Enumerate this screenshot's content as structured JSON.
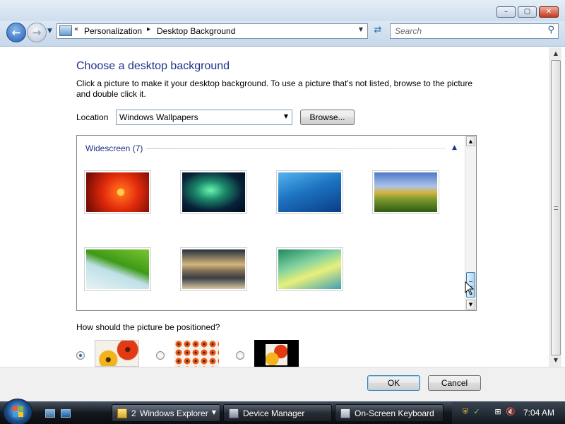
{
  "window": {
    "minimize_icon": "minimize-icon",
    "maximize_icon": "maximize-icon",
    "close_icon": "close-icon"
  },
  "nav": {
    "back_icon": "back-arrow-icon",
    "forward_icon": "forward-arrow-icon",
    "breadcrumb": [
      "Personalization",
      "Desktop Background"
    ],
    "search_placeholder": "Search"
  },
  "page": {
    "heading": "Choose a desktop background",
    "description": "Click a picture to make it your desktop background. To use a picture that's not listed, browse to the picture and double click it.",
    "location_label": "Location",
    "location_value": "Windows Wallpapers",
    "browse_label": "Browse...",
    "group_title": "Widescreen (7)",
    "wallpapers": [
      "red-flower",
      "aurora",
      "dolphins",
      "hills",
      "palm-leaf",
      "mountain-lake",
      "vista-waves"
    ],
    "position_question": "How should the picture be positioned?",
    "position_options": [
      "fill",
      "tile",
      "center"
    ],
    "selected_position": "fill"
  },
  "footer": {
    "ok_label": "OK",
    "cancel_label": "Cancel"
  },
  "taskbar": {
    "tasks": [
      {
        "count": "2",
        "label": "Windows Explorer"
      },
      {
        "label": "Device Manager"
      },
      {
        "label": "On-Screen Keyboard"
      }
    ],
    "clock": "7:04 AM"
  },
  "colors": {
    "heading": "#1e3287",
    "accent": "#2a68b4"
  }
}
